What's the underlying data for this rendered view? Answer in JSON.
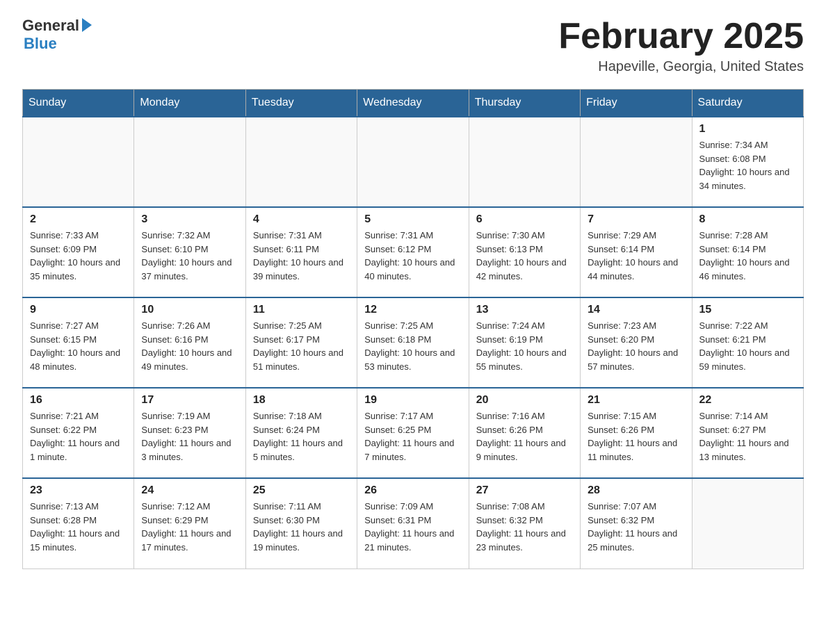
{
  "header": {
    "logo_general": "General",
    "logo_blue": "Blue",
    "title": "February 2025",
    "subtitle": "Hapeville, Georgia, United States"
  },
  "days_of_week": [
    "Sunday",
    "Monday",
    "Tuesday",
    "Wednesday",
    "Thursday",
    "Friday",
    "Saturday"
  ],
  "weeks": [
    [
      {
        "day": "",
        "info": ""
      },
      {
        "day": "",
        "info": ""
      },
      {
        "day": "",
        "info": ""
      },
      {
        "day": "",
        "info": ""
      },
      {
        "day": "",
        "info": ""
      },
      {
        "day": "",
        "info": ""
      },
      {
        "day": "1",
        "info": "Sunrise: 7:34 AM\nSunset: 6:08 PM\nDaylight: 10 hours and 34 minutes."
      }
    ],
    [
      {
        "day": "2",
        "info": "Sunrise: 7:33 AM\nSunset: 6:09 PM\nDaylight: 10 hours and 35 minutes."
      },
      {
        "day": "3",
        "info": "Sunrise: 7:32 AM\nSunset: 6:10 PM\nDaylight: 10 hours and 37 minutes."
      },
      {
        "day": "4",
        "info": "Sunrise: 7:31 AM\nSunset: 6:11 PM\nDaylight: 10 hours and 39 minutes."
      },
      {
        "day": "5",
        "info": "Sunrise: 7:31 AM\nSunset: 6:12 PM\nDaylight: 10 hours and 40 minutes."
      },
      {
        "day": "6",
        "info": "Sunrise: 7:30 AM\nSunset: 6:13 PM\nDaylight: 10 hours and 42 minutes."
      },
      {
        "day": "7",
        "info": "Sunrise: 7:29 AM\nSunset: 6:14 PM\nDaylight: 10 hours and 44 minutes."
      },
      {
        "day": "8",
        "info": "Sunrise: 7:28 AM\nSunset: 6:14 PM\nDaylight: 10 hours and 46 minutes."
      }
    ],
    [
      {
        "day": "9",
        "info": "Sunrise: 7:27 AM\nSunset: 6:15 PM\nDaylight: 10 hours and 48 minutes."
      },
      {
        "day": "10",
        "info": "Sunrise: 7:26 AM\nSunset: 6:16 PM\nDaylight: 10 hours and 49 minutes."
      },
      {
        "day": "11",
        "info": "Sunrise: 7:25 AM\nSunset: 6:17 PM\nDaylight: 10 hours and 51 minutes."
      },
      {
        "day": "12",
        "info": "Sunrise: 7:25 AM\nSunset: 6:18 PM\nDaylight: 10 hours and 53 minutes."
      },
      {
        "day": "13",
        "info": "Sunrise: 7:24 AM\nSunset: 6:19 PM\nDaylight: 10 hours and 55 minutes."
      },
      {
        "day": "14",
        "info": "Sunrise: 7:23 AM\nSunset: 6:20 PM\nDaylight: 10 hours and 57 minutes."
      },
      {
        "day": "15",
        "info": "Sunrise: 7:22 AM\nSunset: 6:21 PM\nDaylight: 10 hours and 59 minutes."
      }
    ],
    [
      {
        "day": "16",
        "info": "Sunrise: 7:21 AM\nSunset: 6:22 PM\nDaylight: 11 hours and 1 minute."
      },
      {
        "day": "17",
        "info": "Sunrise: 7:19 AM\nSunset: 6:23 PM\nDaylight: 11 hours and 3 minutes."
      },
      {
        "day": "18",
        "info": "Sunrise: 7:18 AM\nSunset: 6:24 PM\nDaylight: 11 hours and 5 minutes."
      },
      {
        "day": "19",
        "info": "Sunrise: 7:17 AM\nSunset: 6:25 PM\nDaylight: 11 hours and 7 minutes."
      },
      {
        "day": "20",
        "info": "Sunrise: 7:16 AM\nSunset: 6:26 PM\nDaylight: 11 hours and 9 minutes."
      },
      {
        "day": "21",
        "info": "Sunrise: 7:15 AM\nSunset: 6:26 PM\nDaylight: 11 hours and 11 minutes."
      },
      {
        "day": "22",
        "info": "Sunrise: 7:14 AM\nSunset: 6:27 PM\nDaylight: 11 hours and 13 minutes."
      }
    ],
    [
      {
        "day": "23",
        "info": "Sunrise: 7:13 AM\nSunset: 6:28 PM\nDaylight: 11 hours and 15 minutes."
      },
      {
        "day": "24",
        "info": "Sunrise: 7:12 AM\nSunset: 6:29 PM\nDaylight: 11 hours and 17 minutes."
      },
      {
        "day": "25",
        "info": "Sunrise: 7:11 AM\nSunset: 6:30 PM\nDaylight: 11 hours and 19 minutes."
      },
      {
        "day": "26",
        "info": "Sunrise: 7:09 AM\nSunset: 6:31 PM\nDaylight: 11 hours and 21 minutes."
      },
      {
        "day": "27",
        "info": "Sunrise: 7:08 AM\nSunset: 6:32 PM\nDaylight: 11 hours and 23 minutes."
      },
      {
        "day": "28",
        "info": "Sunrise: 7:07 AM\nSunset: 6:32 PM\nDaylight: 11 hours and 25 minutes."
      },
      {
        "day": "",
        "info": ""
      }
    ]
  ]
}
